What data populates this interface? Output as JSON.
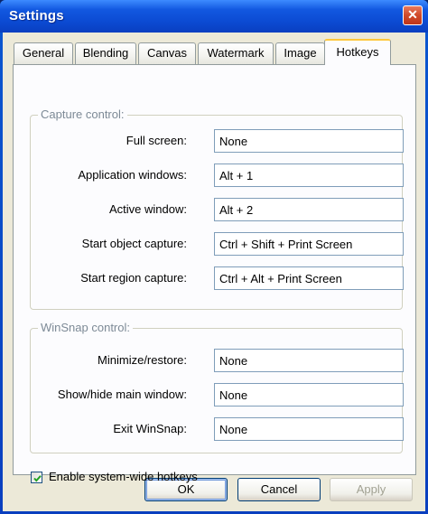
{
  "window": {
    "title": "Settings",
    "close_glyph": "✕"
  },
  "tabs": [
    {
      "label": "General"
    },
    {
      "label": "Blending"
    },
    {
      "label": "Canvas"
    },
    {
      "label": "Watermark"
    },
    {
      "label": "Image"
    },
    {
      "label": "Hotkeys",
      "active": true
    }
  ],
  "capture_control": {
    "title": "Capture control:",
    "rows": [
      {
        "label": "Full screen:",
        "value": "None"
      },
      {
        "label": "Application windows:",
        "value": "Alt + 1"
      },
      {
        "label": "Active window:",
        "value": "Alt + 2"
      },
      {
        "label": "Start object capture:",
        "value": "Ctrl + Shift + Print Screen"
      },
      {
        "label": "Start region capture:",
        "value": "Ctrl + Alt + Print Screen"
      }
    ]
  },
  "winsnap_control": {
    "title": "WinSnap control:",
    "rows": [
      {
        "label": "Minimize/restore:",
        "value": "None"
      },
      {
        "label": "Show/hide main window:",
        "value": "None"
      },
      {
        "label": "Exit WinSnap:",
        "value": "None"
      }
    ]
  },
  "options": {
    "enable_hotkeys_label": "Enable system-wide hotkeys",
    "enable_hotkeys_checked": true
  },
  "buttons": {
    "ok": "OK",
    "cancel": "Cancel",
    "apply": "Apply"
  },
  "colors": {
    "titlebar": "#0b49d1",
    "dialog_bg": "#ece9d8",
    "active_tab_accent": "#ffc83c",
    "group_title": "#7d8a96"
  }
}
